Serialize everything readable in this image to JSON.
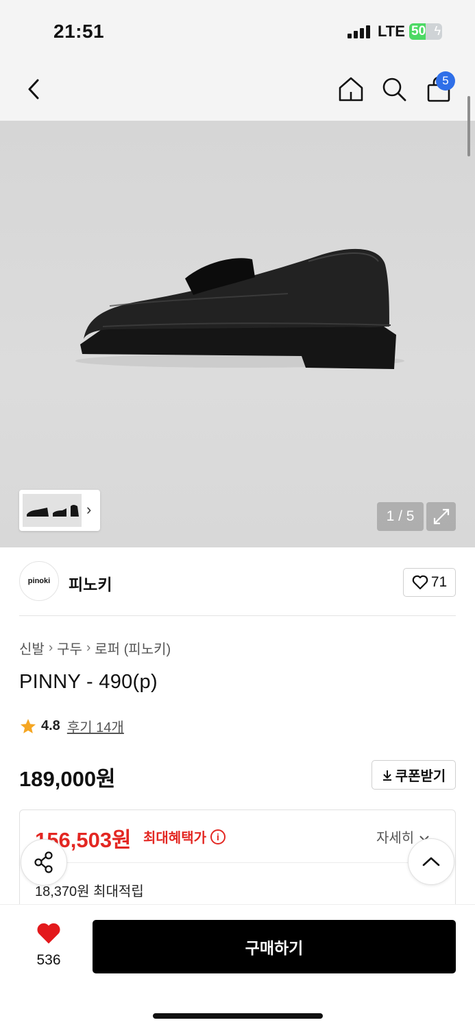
{
  "status_bar": {
    "time": "21:51",
    "network": "LTE",
    "battery": "50",
    "battery_level": 0.5
  },
  "nav": {
    "back_icon": "chevron-left-icon",
    "home_icon": "home-icon",
    "search_icon": "search-icon",
    "cart_icon": "shopping-bag-icon",
    "cart_count": "5"
  },
  "gallery": {
    "counter": "1 / 5",
    "expand_icon": "expand-icon",
    "thumb_chevron": "›"
  },
  "brand": {
    "logo_text": "pinoki",
    "name": "피노키",
    "like_count": "71"
  },
  "breadcrumb": [
    "신발",
    "구두",
    "로퍼 (피노키)"
  ],
  "product": {
    "title": "PINNY - 490(p)",
    "rating": "4.8",
    "reviews": "후기 14개",
    "price": "189,000원",
    "coupon_label": "쿠폰받기"
  },
  "benefit": {
    "max_price": "156,503원",
    "max_label": "최대혜택가",
    "detail_label": "자세히",
    "points": "18,370원 최대적립"
  },
  "bottom": {
    "wish_count": "536",
    "buy_label": "구매하기"
  },
  "colors": {
    "accent_red": "#e32722",
    "badge_blue": "#2f6fe8",
    "buy_black": "#000000",
    "star": "#f5a623"
  }
}
